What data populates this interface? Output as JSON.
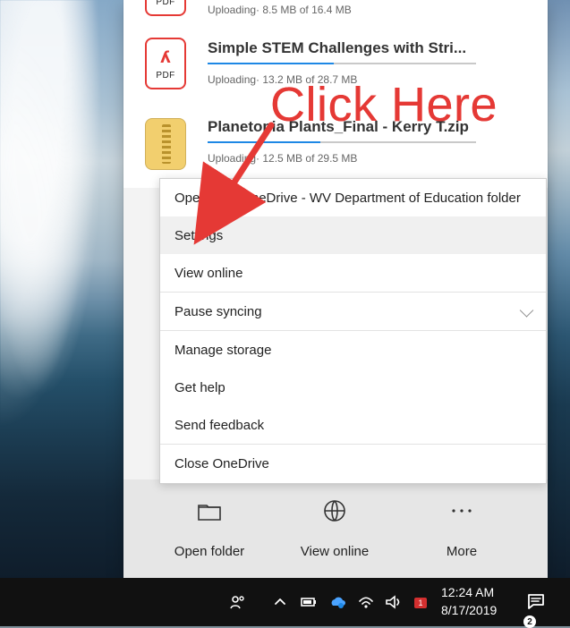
{
  "files": [
    {
      "name": "",
      "status": "Uploading· 8.5 MB of 16.4 MB",
      "progress": 0.52,
      "icon": "pdf-file-icon"
    },
    {
      "name": "Simple STEM Challenges with Stri...",
      "status": "Uploading· 13.2 MB of 28.7 MB",
      "progress": 0.47,
      "icon": "pdf-file-icon"
    },
    {
      "name": "Planetopia Plants_Final - Kerry T.zip",
      "status": "Uploading· 12.5 MB of 29.5 MB",
      "progress": 0.42,
      "icon": "zip-file-icon"
    }
  ],
  "menu": {
    "items": [
      {
        "label": "Open your OneDrive - WV Department of Education folder"
      },
      {
        "label": "Settings",
        "selected": true
      },
      {
        "label": "View online"
      },
      {
        "label": "Pause syncing",
        "has_chevron": true
      },
      {
        "label": "Manage storage"
      },
      {
        "label": "Get help"
      },
      {
        "label": "Send feedback"
      },
      {
        "label": "Close OneDrive"
      }
    ]
  },
  "actions": {
    "open_folder": "Open folder",
    "view_online": "View online",
    "more": "More"
  },
  "annotation": {
    "text": "Click Here",
    "color": "#e53935"
  },
  "taskbar": {
    "time": "12:24 AM",
    "date": "8/17/2019",
    "notifications_count": "2",
    "icons": [
      "people-icon",
      "chevron-up-icon",
      "battery-icon",
      "onedrive-icon",
      "wifi-icon",
      "volume-icon",
      "app-tray-icon",
      "action-center-icon"
    ]
  },
  "colors": {
    "accent_blue": "#1e88e5",
    "pdf_red": "#e53935"
  }
}
